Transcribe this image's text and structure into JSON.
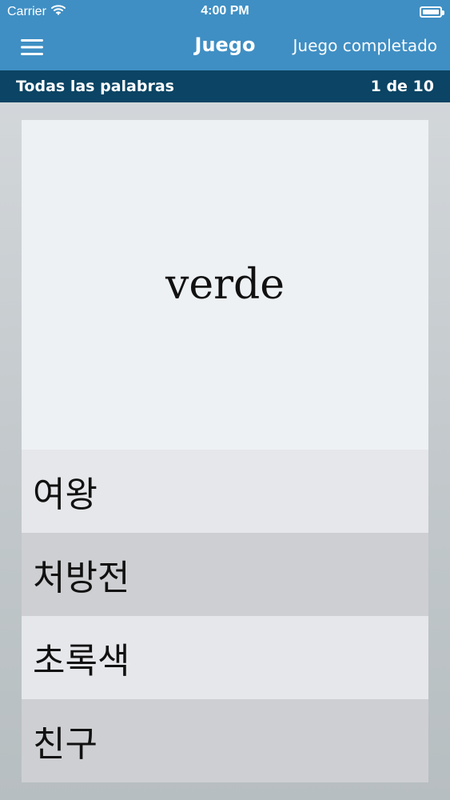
{
  "status_bar": {
    "carrier": "Carrier",
    "time": "4:00 PM"
  },
  "nav": {
    "title": "Juego",
    "right_action": "Juego completado"
  },
  "subheader": {
    "left": "Todas las palabras",
    "right": "1 de 10"
  },
  "card": {
    "prompt": "verde",
    "options": [
      "여왕",
      "처방전",
      "초록색",
      "친구"
    ]
  },
  "colors": {
    "nav_bg": "#3f8fc4",
    "subheader_bg": "#0b4464",
    "prompt_bg": "#eef1f4",
    "option_light": "#e6e7ea",
    "option_dark": "#cecfd2"
  },
  "icons": [
    "wifi-icon",
    "battery-icon",
    "menu-icon"
  ]
}
